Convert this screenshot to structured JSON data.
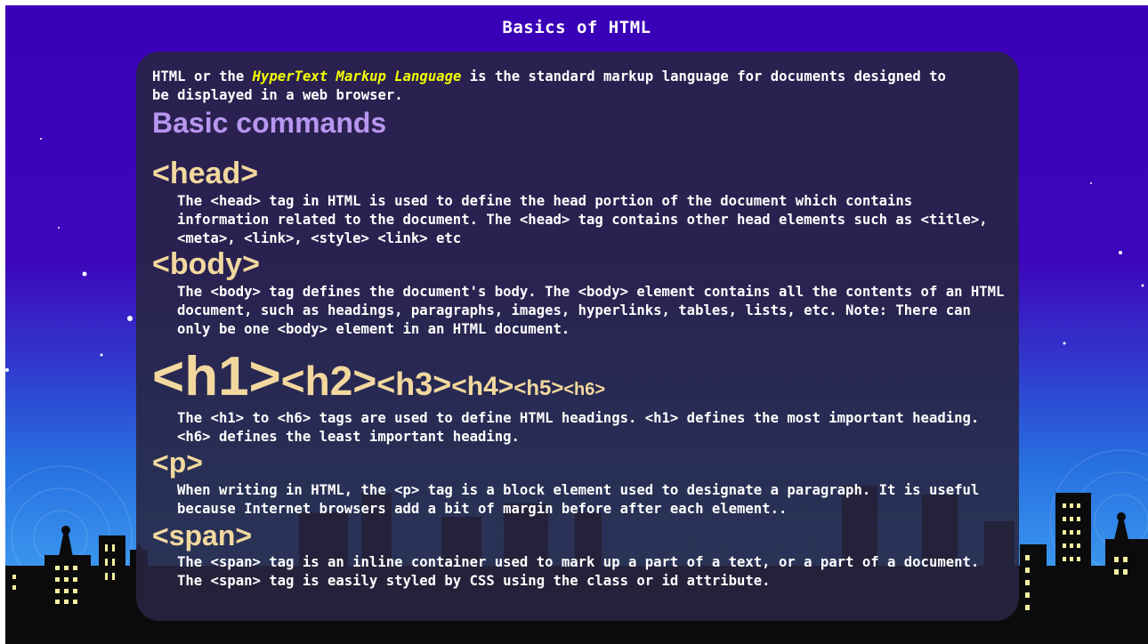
{
  "page": {
    "title": "Basics of HTML"
  },
  "intro": {
    "before": "HTML or the ",
    "highlight": "HyperText Markup Language",
    "after": " is the standard markup language for documents designed to be displayed in a web browser."
  },
  "section_title": "Basic commands",
  "sections": {
    "head": {
      "tag": "<head>",
      "text": "The <head> tag in HTML is used to define the head portion of the document which contains information related to the document. The <head> tag contains other head elements such as <title>, <meta>, <link>, <style> <link> etc"
    },
    "body": {
      "tag": "<body>",
      "text": "The <body> tag defines the document's body. The <body> element contains all the contents of an HTML document, such as headings, paragraphs, images, hyperlinks, tables, lists, etc. Note: There can only be one <body> element in an HTML document."
    },
    "headings": {
      "h1": "<h1>",
      "h2": "<h2>",
      "h3": "<h3>",
      "h4": "<h4>",
      "h5": "<h5>",
      "h6": "<h6>",
      "text": "The <h1> to <h6> tags are used to define HTML headings. <h1> defines the most important heading. <h6> defines the least important heading."
    },
    "p": {
      "tag": "<p>",
      "text": "When writing in HTML, the <p> tag is a block element used to designate a paragraph. It is useful because Internet browsers add a bit of margin before after each element.."
    },
    "span": {
      "tag": "<span>",
      "text": "The <span> tag is an inline container used to mark up a part of a text, or a part of a document. The <span> tag is easily styled by CSS using the class or id attribute."
    }
  },
  "colors": {
    "sky_top": "#3a00b8",
    "sky_bottom": "#3aa0f0",
    "panel": "#28263f",
    "highlight": "#f2ff00",
    "section_title": "#b896f0",
    "tag": "#f2d89e",
    "window_light": "#f5f0a0"
  },
  "background": {
    "icons": [
      "stars",
      "city-skyline",
      "radio-towers"
    ]
  }
}
